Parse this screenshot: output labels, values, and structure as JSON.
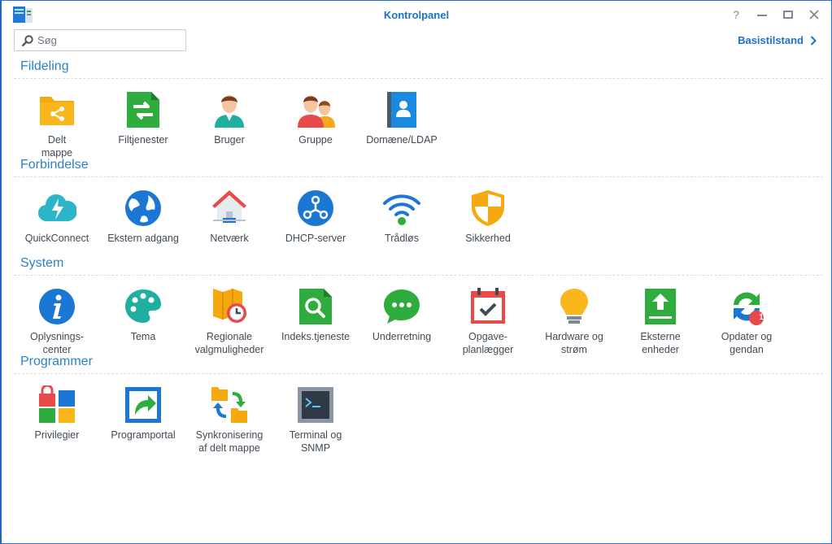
{
  "window": {
    "title": "Kontrolpanel",
    "help_label": "?",
    "accent_color": "#1a73c8"
  },
  "search": {
    "placeholder": "Søg"
  },
  "header": {
    "basic_mode_label": "Basistilstand"
  },
  "sections": [
    {
      "title": "Fildeling",
      "items": [
        {
          "label": "Delt\nmappe",
          "icon": "shared-folder-icon"
        },
        {
          "label": "Filtjenester",
          "icon": "file-services-icon"
        },
        {
          "label": "Bruger",
          "icon": "user-icon"
        },
        {
          "label": "Gruppe",
          "icon": "group-icon"
        },
        {
          "label": "Domæne/LDAP",
          "icon": "domain-ldap-icon"
        }
      ]
    },
    {
      "title": "Forbindelse",
      "items": [
        {
          "label": "QuickConnect",
          "icon": "quickconnect-icon"
        },
        {
          "label": "Ekstern adgang",
          "icon": "external-access-icon"
        },
        {
          "label": "Netværk",
          "icon": "network-icon"
        },
        {
          "label": "DHCP-server",
          "icon": "dhcp-server-icon"
        },
        {
          "label": "Trådløs",
          "icon": "wireless-icon"
        },
        {
          "label": "Sikkerhed",
          "icon": "security-icon"
        }
      ]
    },
    {
      "title": "System",
      "items": [
        {
          "label": "Oplysnings-\ncenter",
          "icon": "info-center-icon"
        },
        {
          "label": "Tema",
          "icon": "theme-icon"
        },
        {
          "label": "Regionale\nvalgmuligheder",
          "icon": "regional-options-icon"
        },
        {
          "label": "Indeks.tjeneste",
          "icon": "indexing-service-icon"
        },
        {
          "label": "Underretning",
          "icon": "notification-icon"
        },
        {
          "label": "Opgave-\nplanlægger",
          "icon": "task-scheduler-icon"
        },
        {
          "label": "Hardware og\nstrøm",
          "icon": "hardware-power-icon"
        },
        {
          "label": "Eksterne\nenheder",
          "icon": "external-devices-icon"
        },
        {
          "label": "Opdater og\ngendan",
          "icon": "update-restore-icon",
          "badge": "1"
        }
      ]
    },
    {
      "title": "Programmer",
      "items": [
        {
          "label": "Privilegier",
          "icon": "privileges-icon"
        },
        {
          "label": "Programportal",
          "icon": "application-portal-icon"
        },
        {
          "label": "Synkronisering\naf delt mappe",
          "icon": "shared-folder-sync-icon"
        },
        {
          "label": "Terminal og\nSNMP",
          "icon": "terminal-snmp-icon"
        }
      ]
    }
  ]
}
